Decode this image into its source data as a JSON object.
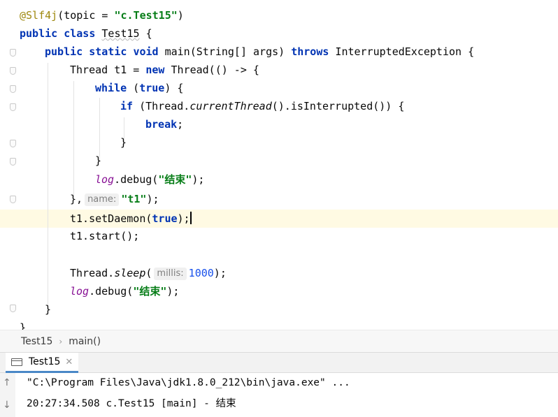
{
  "editor": {
    "line1": {
      "annotation": "@Slf4j",
      "param": "topic",
      "eq": " = ",
      "value": "\"c.Test15\"",
      "close": ")"
    },
    "line2": {
      "kw1": "public",
      "kw2": "class",
      "name": "Test15",
      "brace": " {"
    },
    "line3": {
      "kw1": "public",
      "kw2": "static",
      "kw3": "void",
      "sig": " main(String[] args) ",
      "throws": "throws",
      "exc": " InterruptedException {"
    },
    "line4": {
      "pre": "Thread t1 = ",
      "new": "new",
      "post": " Thread(() -> {"
    },
    "line5": {
      "while": "while",
      "open": " (",
      "true": "true",
      "close": ") {"
    },
    "line6": {
      "if": "if",
      "a": " (Thread.",
      "method": "currentThread",
      "b": "().isInterrupted()) {"
    },
    "line7": {
      "break": "break",
      "semi": ";"
    },
    "line8": "}",
    "line9": "}",
    "line10": {
      "log": "log",
      "call": ".debug(",
      "msg": "\"结束\"",
      "end": ");"
    },
    "line11": {
      "pre": "},",
      "hint": "name:",
      "value": "\"t1\"",
      "end": ");"
    },
    "line12": {
      "pre": "t1.setDaemon(",
      "true": "true",
      "end": ");"
    },
    "line13": "t1.start();",
    "line14": {
      "pre": "Thread.",
      "method": "sleep",
      "open": "(",
      "hint": "millis:",
      "value": "1000",
      "end": ");"
    },
    "line15": {
      "log": "log",
      "call": ".debug(",
      "msg": "\"结束\"",
      "end": ");"
    },
    "line16": "}",
    "line17": "}"
  },
  "breadcrumb": {
    "class": "Test15",
    "method": "main()"
  },
  "run": {
    "tab_label": "Test15",
    "close": "✕"
  },
  "console": {
    "up_icon": "↑",
    "down_icon": "↓",
    "lines": [
      "\"C:\\Program Files\\Java\\jdk1.8.0_212\\bin\\java.exe\" ...",
      "20:27:34.508 c.Test15 [main] - 结束"
    ]
  },
  "colors": {
    "keyword": "#0033b3",
    "string": "#067d17",
    "annotation": "#9e880d",
    "number": "#1750eb",
    "field": "#871094",
    "current_line": "#fffae3",
    "tab_underline": "#4a88c7"
  },
  "icons": [
    "fold-marker-icon",
    "console-window-icon",
    "close-icon",
    "up-arrow-icon",
    "down-arrow-icon"
  ]
}
